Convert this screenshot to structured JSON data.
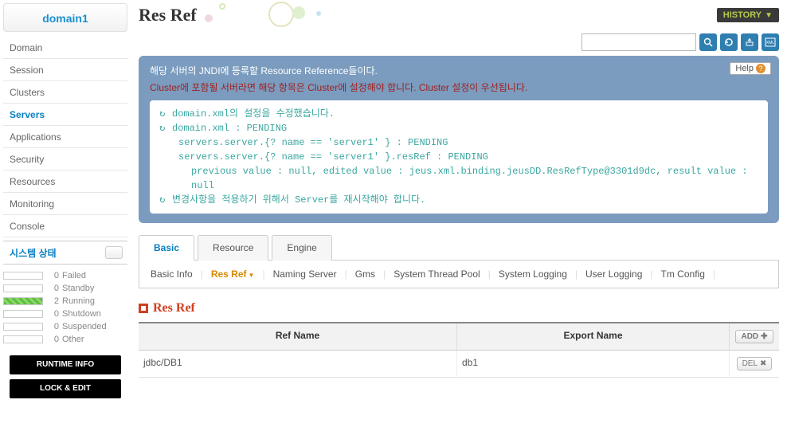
{
  "domain_title": "domain1",
  "nav": [
    {
      "label": "Domain",
      "active": false
    },
    {
      "label": "Session",
      "active": false
    },
    {
      "label": "Clusters",
      "active": false
    },
    {
      "label": "Servers",
      "active": true
    },
    {
      "label": "Applications",
      "active": false
    },
    {
      "label": "Security",
      "active": false
    },
    {
      "label": "Resources",
      "active": false
    },
    {
      "label": "Monitoring",
      "active": false
    },
    {
      "label": "Console",
      "active": false
    }
  ],
  "system_status": {
    "title": "시스템 상태",
    "items": [
      {
        "count": "0",
        "label": "Failed",
        "running": false
      },
      {
        "count": "0",
        "label": "Standby",
        "running": false
      },
      {
        "count": "2",
        "label": "Running",
        "running": true
      },
      {
        "count": "0",
        "label": "Shutdown",
        "running": false
      },
      {
        "count": "0",
        "label": "Suspended",
        "running": false
      },
      {
        "count": "0",
        "label": "Other",
        "running": false
      }
    ]
  },
  "side_buttons": {
    "runtime": "RUNTIME INFO",
    "lock": "LOCK & EDIT"
  },
  "page_title": "Res Ref",
  "history_label": "HISTORY",
  "info": {
    "desc": "해당 서버의 JNDI에 등록할 Resource Reference들이다.",
    "warn": "Cluster에 포함될 서버라면 해당 항목은 Cluster에 설정해야 합니다. Cluster 설정이 우선됩니다.",
    "help": "Help"
  },
  "log": {
    "l1": "domain.xml의 설정을 수정했습니다.",
    "l2": "domain.xml : PENDING",
    "l3": "servers.server.{? name == 'server1' } : PENDING",
    "l4": "servers.server.{? name == 'server1' }.resRef : PENDING",
    "l5": "previous value : null, edited value : jeus.xml.binding.jeusDD.ResRefType@3301d9dc, result value : null",
    "l6": "변경사항을 적용하기 위해서 Server를 재시작해야 합니다."
  },
  "tabs": [
    {
      "label": "Basic",
      "active": true
    },
    {
      "label": "Resource",
      "active": false
    },
    {
      "label": "Engine",
      "active": false
    }
  ],
  "subtabs": [
    {
      "label": "Basic Info",
      "active": false
    },
    {
      "label": "Res Ref",
      "active": true,
      "dropdown": true
    },
    {
      "label": "Naming Server",
      "active": false
    },
    {
      "label": "Gms",
      "active": false
    },
    {
      "label": "System Thread Pool",
      "active": false
    },
    {
      "label": "System Logging",
      "active": false
    },
    {
      "label": "User Logging",
      "active": false
    },
    {
      "label": "Tm Config",
      "active": false
    }
  ],
  "section_title": "Res Ref",
  "table": {
    "headers": {
      "ref": "Ref Name",
      "export": "Export Name",
      "add": "ADD"
    },
    "rows": [
      {
        "ref": "jdbc/DB1",
        "export": "db1",
        "del": "DEL"
      }
    ]
  }
}
